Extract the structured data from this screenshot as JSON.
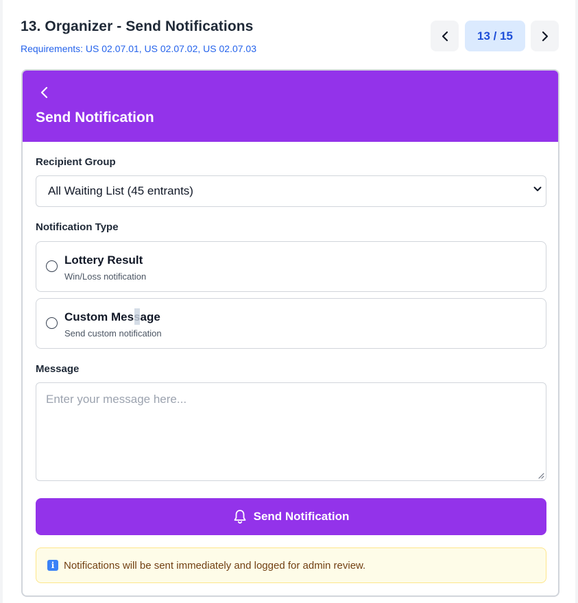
{
  "screen": {
    "title": "13. Organizer - Send Notifications",
    "requirements": "Requirements: US 02.07.01, US 02.07.02, US 02.07.03",
    "pager": {
      "current": 13,
      "total": 15,
      "label": "13 / 15"
    }
  },
  "header": {
    "back_icon": "chevron-left-icon",
    "title": "Send Notification"
  },
  "recipient": {
    "label": "Recipient Group",
    "selected": "All Waiting List (45 entrants)"
  },
  "notification_type": {
    "label": "Notification Type",
    "options": [
      {
        "title": "Lottery Result",
        "description": "Win/Loss notification",
        "selected": false
      },
      {
        "title": "Custom Message",
        "description": "Send custom notification",
        "selected": false
      }
    ]
  },
  "message": {
    "label": "Message",
    "placeholder": "Enter your message here...",
    "value": ""
  },
  "send_button": {
    "label": "Send Notification",
    "icon": "bell-icon"
  },
  "info": {
    "icon": "info-icon",
    "text": "Notifications will be sent immediately and logged for admin review."
  },
  "colors": {
    "primary": "#9333ea",
    "link": "#2563eb",
    "pager_bg": "#dbeafe",
    "info_bg": "#fefce8",
    "info_border": "#fde68a"
  }
}
